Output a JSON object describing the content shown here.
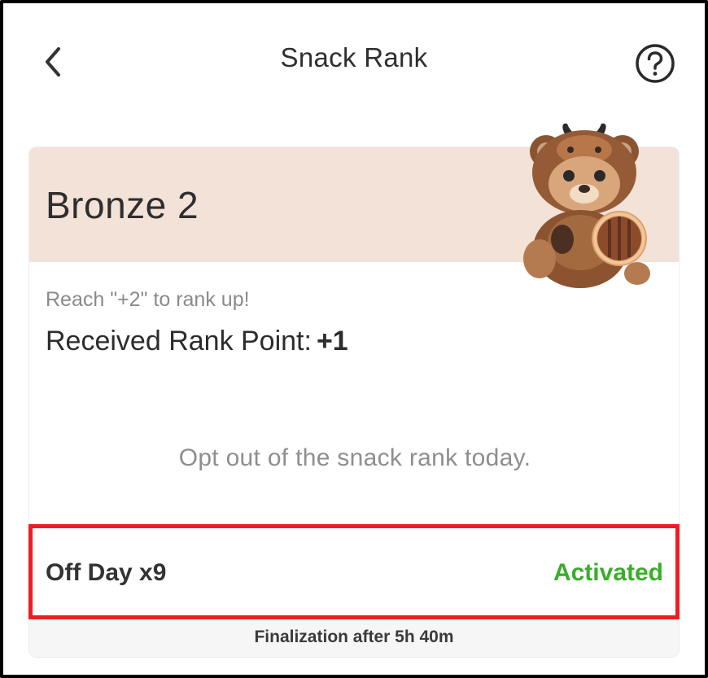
{
  "header": {
    "title": "Snack Rank",
    "back_icon": "chevron-left-icon",
    "help_icon": "question-circle-icon"
  },
  "rank": {
    "name": "Bronze 2",
    "mascot": "bear-mascot"
  },
  "progress": {
    "hint": "Reach \"+2\" to rank up!",
    "points_label": "Received Rank Point:",
    "points_value": "+1"
  },
  "status_message": "Opt out of the snack rank today.",
  "off_day": {
    "label": "Off Day x9",
    "status": "Activated"
  },
  "footer": {
    "finalization": "Finalization after 5h 40m"
  },
  "colors": {
    "banner": "#f3e2d7",
    "activated": "#3aad2a",
    "highlight": "#ef1c24"
  }
}
